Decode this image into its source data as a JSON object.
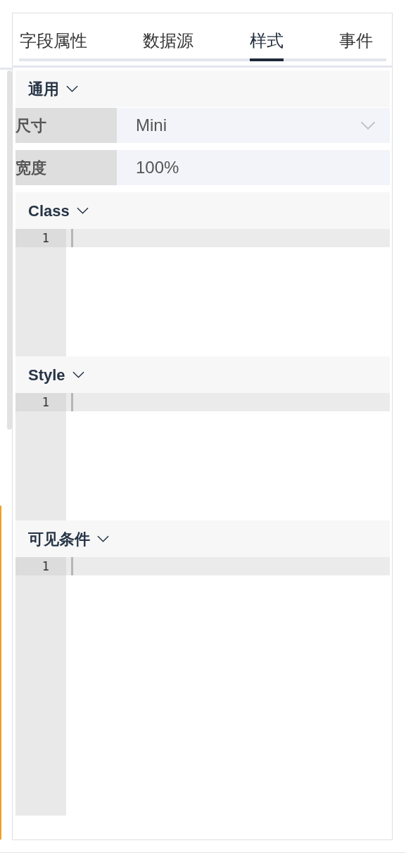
{
  "tabs": [
    {
      "label": "字段属性",
      "selected": false
    },
    {
      "label": "数据源",
      "selected": false
    },
    {
      "label": "样式",
      "selected": true
    },
    {
      "label": "事件",
      "selected": false
    }
  ],
  "sections": [
    {
      "title": "通用",
      "kind": "form",
      "expanded": true,
      "fields": [
        {
          "label": "尺寸",
          "kind": "select",
          "value": "Mini"
        },
        {
          "label": "宽度",
          "kind": "text",
          "value": "100%"
        }
      ]
    },
    {
      "title": "Class",
      "kind": "code",
      "expanded": true,
      "lines": [
        "1"
      ]
    },
    {
      "title": "Style",
      "kind": "code",
      "expanded": true,
      "lines": [
        "1"
      ]
    },
    {
      "title": "可见条件",
      "kind": "code",
      "expanded": true,
      "lines": [
        "1"
      ]
    }
  ]
}
